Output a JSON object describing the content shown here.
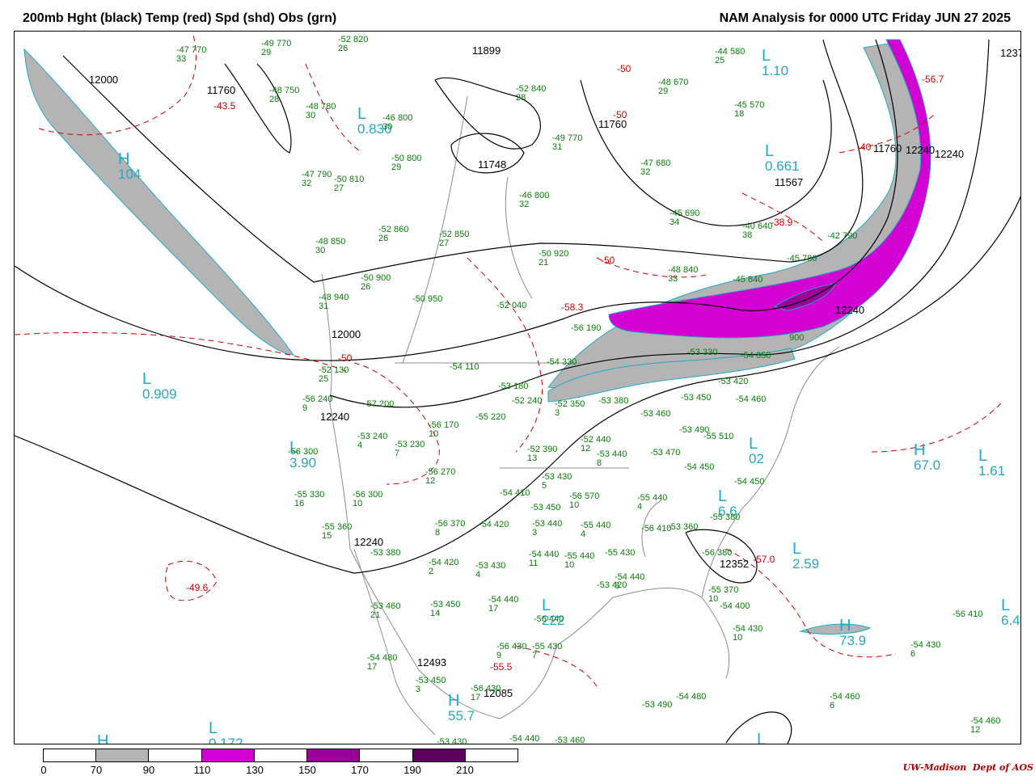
{
  "title_left": "200mb Hght (black) Temp (red) Spd (shd) Obs (grn)",
  "title_right": "NAM Analysis for 0000 UTC Friday  JUN 27 2025",
  "credit_org": "UW-Madison",
  "credit_dept": "Dept of AOS",
  "colors": {
    "height_contour": "#000000",
    "temperature_contour": "#cc0000",
    "observation": "#0a7a0a",
    "pressure_center": "#21a9c8",
    "speed_70_90": "#b4b4b4",
    "speed_110_130": "#d200d2",
    "speed_150_170": "#9a009a",
    "speed_190_210": "#5e005e",
    "map_lines": "#8c8c8c"
  },
  "legend": {
    "ticks": [
      "0",
      "70",
      "90",
      "110",
      "130",
      "150",
      "170",
      "190",
      "210"
    ],
    "segments": [
      "#ffffff",
      "#b4b4b4",
      "#ffffff",
      "#d200d2",
      "#ffffff",
      "#9a009a",
      "#ffffff",
      "#5e005e",
      "#ffffff"
    ]
  },
  "height_labels": [
    "12000",
    "11760",
    "11899",
    "11760",
    "11748",
    "11567",
    "11760",
    "12240",
    "12000",
    "12240",
    "12240",
    "12240",
    "12240",
    "12493",
    "12085",
    "12352",
    "1237"
  ],
  "temperature_labels": [
    "-43.5",
    "-50",
    "-50",
    "-50",
    "-58.3",
    "-38.9",
    "-56.7",
    "-40",
    "-50",
    "-57.0",
    "-49.6",
    "-55.5"
  ],
  "centers": [
    {
      "type": "H",
      "value": "104"
    },
    {
      "type": "L",
      "value": "0.909"
    },
    {
      "type": "L",
      "value": "0.830"
    },
    {
      "type": "L",
      "value": "1.10"
    },
    {
      "type": "L",
      "value": "0.661"
    },
    {
      "type": "H",
      "value": "67.0"
    },
    {
      "type": "L",
      "value": "1.61"
    },
    {
      "type": "L",
      "value": "2.59"
    },
    {
      "type": "H",
      "value": "73.9"
    },
    {
      "type": "H",
      "value": "55.7"
    },
    {
      "type": "L",
      "value": "0.172"
    },
    {
      "type": "L",
      "value": "3.90"
    },
    {
      "type": "L",
      "value": "222"
    },
    {
      "type": "L",
      "value": "6.4"
    },
    {
      "type": "L",
      "value": "02"
    },
    {
      "type": "L",
      "value": "6.6"
    },
    {
      "type": "H",
      "value": ""
    },
    {
      "type": "L",
      "value": ""
    }
  ],
  "observations": [
    {
      "t": "-47",
      "d": "33",
      "h": "770"
    },
    {
      "t": "-49",
      "d": "29",
      "h": "770"
    },
    {
      "t": "-52",
      "d": "26",
      "h": "820"
    },
    {
      "t": "-48",
      "d": "28",
      "h": "750"
    },
    {
      "t": "-48",
      "d": "30",
      "h": "780"
    },
    {
      "t": "-46",
      "d": "30",
      "h": "800"
    },
    {
      "t": "-52",
      "d": "28",
      "h": "840"
    },
    {
      "t": "-48",
      "d": "29",
      "h": "670"
    },
    {
      "t": "-44",
      "d": "25",
      "h": "580"
    },
    {
      "t": "-45",
      "d": "18",
      "h": "570"
    },
    {
      "t": "-49",
      "d": "31",
      "h": "770"
    },
    {
      "t": "-47",
      "d": "32",
      "h": "680"
    },
    {
      "t": "-50",
      "d": "29",
      "h": "800"
    },
    {
      "t": "-47",
      "d": "32",
      "h": "790"
    },
    {
      "t": "-50",
      "d": "27",
      "h": "810"
    },
    {
      "t": "-46",
      "d": "32",
      "h": "800"
    },
    {
      "t": "-45",
      "d": "34",
      "h": "690"
    },
    {
      "t": "-40",
      "d": "38",
      "h": "640"
    },
    {
      "t": "-42",
      "d": "",
      "h": "790"
    },
    {
      "t": "-45",
      "d": "",
      "h": "780"
    },
    {
      "t": "-52",
      "d": "26",
      "h": "860"
    },
    {
      "t": "-52",
      "d": "27",
      "h": "850"
    },
    {
      "t": "-48",
      "d": "30",
      "h": "850"
    },
    {
      "t": "-50",
      "d": "21",
      "h": "920"
    },
    {
      "t": "-48",
      "d": "33",
      "h": "840"
    },
    {
      "t": "-45",
      "d": "",
      "h": "840"
    },
    {
      "t": "-50",
      "d": "26",
      "h": "900"
    },
    {
      "t": "-48",
      "d": "31",
      "h": "940"
    },
    {
      "t": "-50",
      "d": "",
      "h": "950"
    },
    {
      "t": "-52",
      "d": "",
      "h": "040"
    },
    {
      "t": "-56",
      "d": "",
      "h": "190"
    },
    {
      "t": "-54",
      "d": "",
      "h": "110"
    },
    {
      "t": "-52",
      "d": "25",
      "h": "130"
    },
    {
      "t": "-54",
      "d": "",
      "h": "330"
    },
    {
      "t": "-53",
      "d": "",
      "h": "330"
    },
    {
      "t": "-54",
      "d": "",
      "h": "350"
    },
    {
      "t": "",
      "d": "",
      "h": "900"
    },
    {
      "t": "-53",
      "d": "",
      "h": "180"
    },
    {
      "t": "-52",
      "d": "",
      "h": "240"
    },
    {
      "t": "-52",
      "d": "3",
      "h": "350"
    },
    {
      "t": "-53",
      "d": "",
      "h": "380"
    },
    {
      "t": "-53",
      "d": "",
      "h": "420"
    },
    {
      "t": "-53",
      "d": "",
      "h": "450"
    },
    {
      "t": "-54",
      "d": "",
      "h": "460"
    },
    {
      "t": "-56",
      "d": "9",
      "h": "240"
    },
    {
      "t": "-57",
      "d": "",
      "h": "200"
    },
    {
      "t": "-56",
      "d": "10",
      "h": "170"
    },
    {
      "t": "-55",
      "d": "",
      "h": "220"
    },
    {
      "t": "-53",
      "d": "",
      "h": "460"
    },
    {
      "t": "-53",
      "d": "",
      "h": "490"
    },
    {
      "t": "-53",
      "d": "4",
      "h": "240"
    },
    {
      "t": "-53",
      "d": "7",
      "h": "230"
    },
    {
      "t": "-52",
      "d": "12",
      "h": "440"
    },
    {
      "t": "-55",
      "d": "",
      "h": "510"
    },
    {
      "t": "-56",
      "d": "",
      "h": "300"
    },
    {
      "t": "-52",
      "d": "13",
      "h": "390"
    },
    {
      "t": "-53",
      "d": "8",
      "h": "440"
    },
    {
      "t": "-53",
      "d": "",
      "h": "470"
    },
    {
      "t": "-54",
      "d": "",
      "h": "450"
    },
    {
      "t": "-56",
      "d": "12",
      "h": "270"
    },
    {
      "t": "-53",
      "d": "5",
      "h": "430"
    },
    {
      "t": "-54",
      "d": "",
      "h": "450"
    },
    {
      "t": "-55",
      "d": "16",
      "h": "330"
    },
    {
      "t": "-56",
      "d": "10",
      "h": "300"
    },
    {
      "t": "-54",
      "d": "",
      "h": "410"
    },
    {
      "t": "-56",
      "d": "10",
      "h": "570"
    },
    {
      "t": "-55",
      "d": "4",
      "h": "440"
    },
    {
      "t": "-55",
      "d": "",
      "h": "380"
    },
    {
      "t": "-53",
      "d": "",
      "h": "450"
    },
    {
      "t": "-55",
      "d": "15",
      "h": "360"
    },
    {
      "t": "-56",
      "d": "8",
      "h": "370"
    },
    {
      "t": "-54",
      "d": "",
      "h": "420"
    },
    {
      "t": "-53",
      "d": "3",
      "h": "440"
    },
    {
      "t": "-55",
      "d": "4",
      "h": "440"
    },
    {
      "t": "-56",
      "d": "",
      "h": "410"
    },
    {
      "t": "-53",
      "d": "",
      "h": "360"
    },
    {
      "t": "-53",
      "d": "",
      "h": "380"
    },
    {
      "t": "-54",
      "d": "2",
      "h": "420"
    },
    {
      "t": "-53",
      "d": "4",
      "h": "430"
    },
    {
      "t": "-54",
      "d": "11",
      "h": "440"
    },
    {
      "t": "-55",
      "d": "10",
      "h": "440"
    },
    {
      "t": "-55",
      "d": "",
      "h": "430"
    },
    {
      "t": "-54",
      "d": "3",
      "h": "440"
    },
    {
      "t": "-56",
      "d": "",
      "h": "380"
    },
    {
      "t": "-53",
      "d": "21",
      "h": "460"
    },
    {
      "t": "-53",
      "d": "14",
      "h": "450"
    },
    {
      "t": "-54",
      "d": "17",
      "h": "440"
    },
    {
      "t": "-53",
      "d": "",
      "h": "420"
    },
    {
      "t": "-55",
      "d": "10",
      "h": "370"
    },
    {
      "t": "-54",
      "d": "",
      "h": "400"
    },
    {
      "t": "-56",
      "d": "",
      "h": "410"
    },
    {
      "t": "-56",
      "d": "",
      "h": "440"
    },
    {
      "t": "-54",
      "d": "17",
      "h": "480"
    },
    {
      "t": "-56",
      "d": "9",
      "h": "430"
    },
    {
      "t": "-55",
      "d": "7",
      "h": "430"
    },
    {
      "t": "-54",
      "d": "10",
      "h": "430"
    },
    {
      "t": "-54",
      "d": "6",
      "h": "430"
    },
    {
      "t": "-53",
      "d": "3",
      "h": "450"
    },
    {
      "t": "-56",
      "d": "17",
      "h": "430"
    },
    {
      "t": "-54",
      "d": "",
      "h": "480"
    },
    {
      "t": "-53",
      "d": "",
      "h": "490"
    },
    {
      "t": "-54",
      "d": "6",
      "h": "460"
    },
    {
      "t": "-54",
      "d": "12",
      "h": "460"
    },
    {
      "t": "-53",
      "d": "",
      "h": "430"
    },
    {
      "t": "-54",
      "d": "",
      "h": "440"
    },
    {
      "t": "-53",
      "d": "",
      "h": "460"
    }
  ]
}
